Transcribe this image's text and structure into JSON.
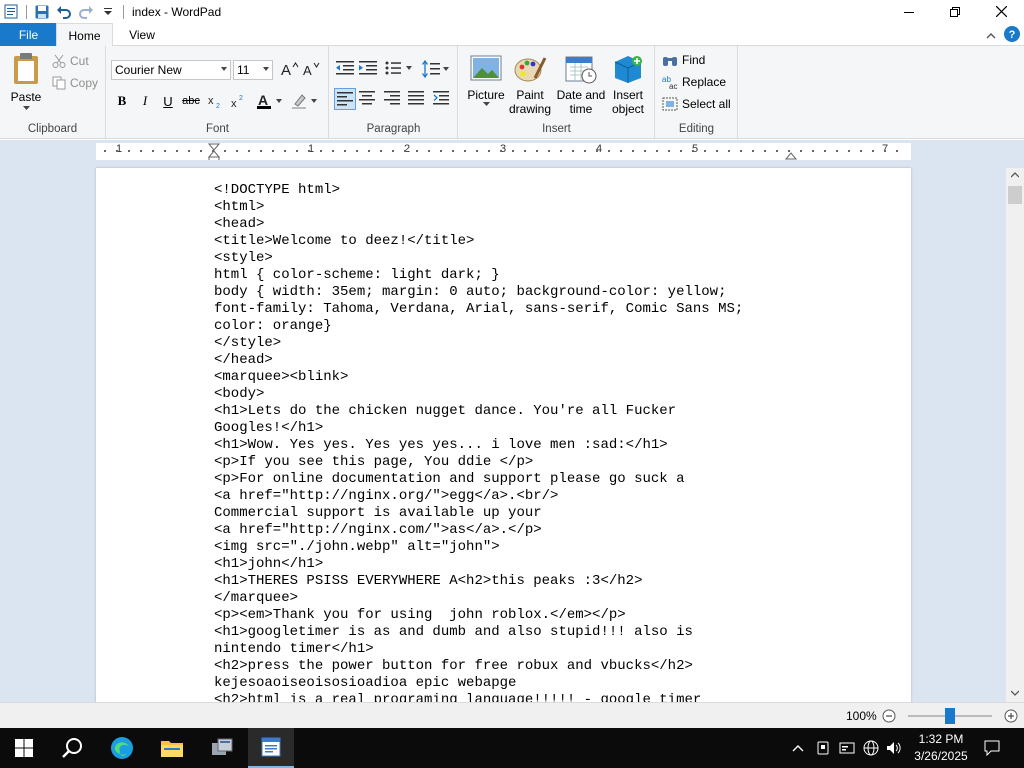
{
  "window": {
    "title": "index - WordPad"
  },
  "tabs": {
    "file": "File",
    "home": "Home",
    "view": "View"
  },
  "clipboard": {
    "paste": "Paste",
    "cut": "Cut",
    "copy": "Copy",
    "label": "Clipboard"
  },
  "font": {
    "family": "Courier New",
    "size": "11",
    "label": "Font"
  },
  "paragraph": {
    "label": "Paragraph"
  },
  "insert": {
    "picture": "Picture",
    "paint_line1": "Paint",
    "paint_line2": "drawing",
    "datetime_line1": "Date and",
    "datetime_line2": "time",
    "object_line1": "Insert",
    "object_line2": "object",
    "label": "Insert"
  },
  "editing": {
    "find": "Find",
    "replace": "Replace",
    "select_all": "Select all",
    "label": "Editing"
  },
  "ruler": {
    "labels": [
      "1",
      "1",
      "2",
      "3",
      "4",
      "5",
      "7"
    ]
  },
  "document": {
    "lines": [
      "<!DOCTYPE html>",
      "<html>",
      "<head>",
      "<title>Welcome to deez!</title>",
      "<style>",
      "html { color-scheme: light dark; }",
      "body { width: 35em; margin: 0 auto; background-color: yellow;",
      "font-family: Tahoma, Verdana, Arial, sans-serif, Comic Sans MS;",
      "color: orange}",
      "</style>",
      "</head>",
      "<marquee><blink>",
      "<body>",
      "<h1>Lets do the chicken nugget dance. You're all Fucker",
      "Googles!</h1>",
      "<h1>Wow. Yes yes. Yes yes yes... i love men :sad:</h1>",
      "<p>If you see this page, You ddie </p>",
      "<p>For online documentation and support please go suck a",
      "<a href=\"http://nginx.org/\">egg</a>.<br/>",
      "Commercial support is available up your",
      "<a href=\"http://nginx.com/\">as</a>.</p>",
      "<img src=\"./john.webp\" alt=\"john\">",
      "<h1>john</h1>",
      "<h1>THERES PSISS EVERYWHERE A<h2>this peaks :3</h2>",
      "</marquee>",
      "<p><em>Thank you for using  john roblox.</em></p>",
      "<h1>googletimer is as and dumb and also stupid!!! also is",
      "nintendo timer</h1>",
      "<h2>press the power button for free robux and vbucks</h2>",
      "kejesoaoiseoisosioadioa epic webapge",
      "<h2>html is a real programing language!!!!! - google timer"
    ]
  },
  "status": {
    "zoom": "100%"
  },
  "taskbar": {
    "time": "1:32 PM",
    "date": "3/26/2025"
  },
  "colors": {
    "accent": "#1979ca",
    "ribbon_bg": "#f5f6f7",
    "workspace_bg": "#dbe5f1"
  }
}
